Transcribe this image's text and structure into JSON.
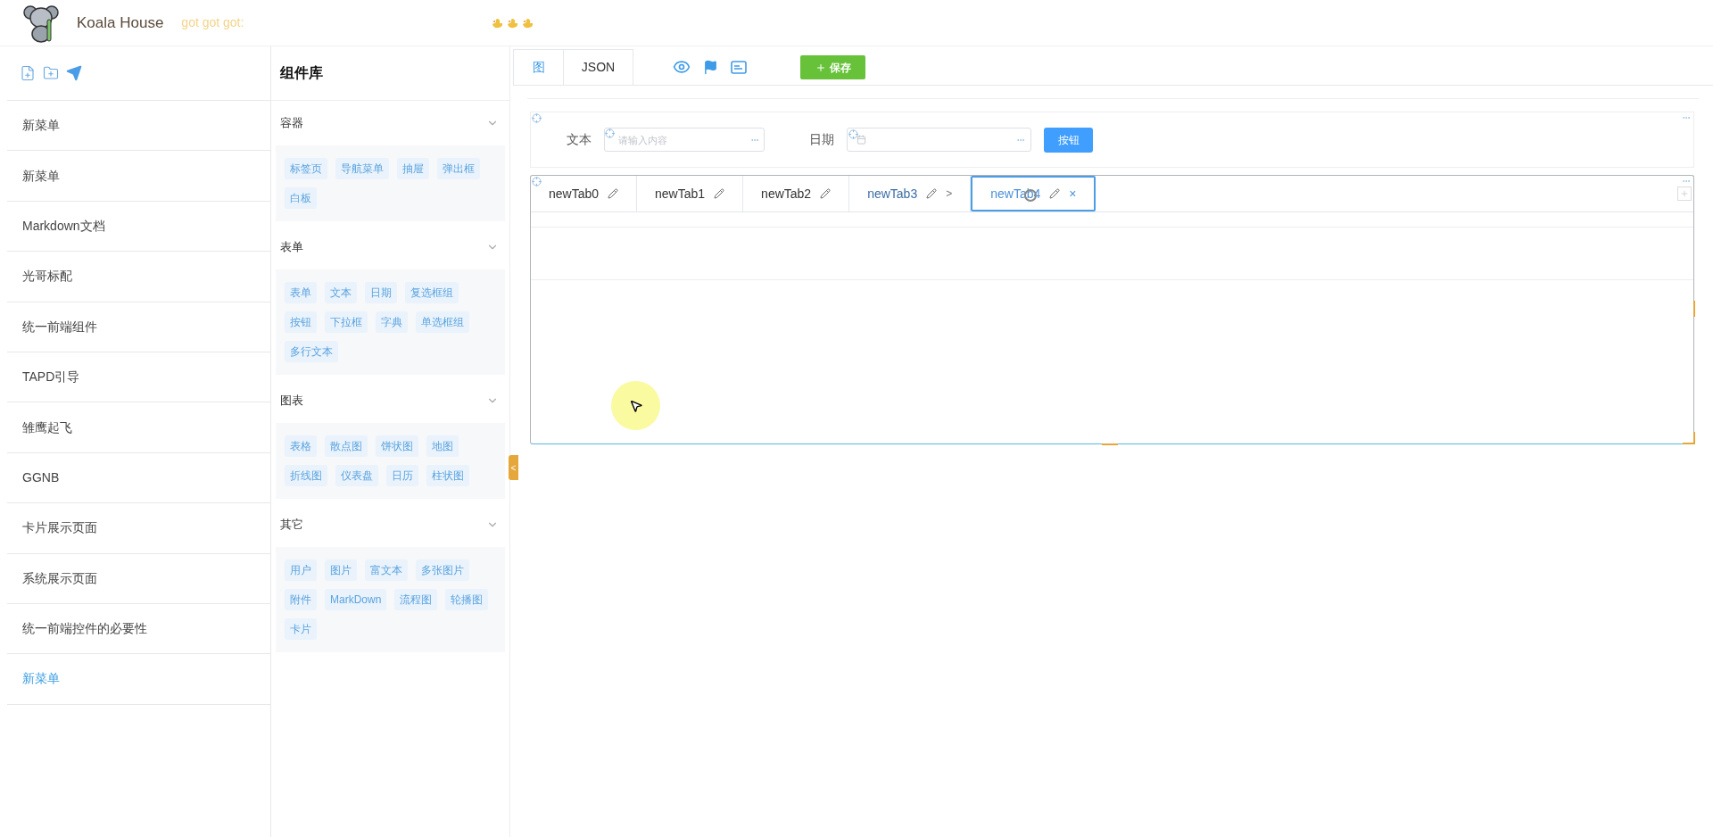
{
  "header": {
    "brand": "Koala House",
    "tagline": "got got got:"
  },
  "sidebar": {
    "items": [
      {
        "label": "新菜单",
        "selected": false
      },
      {
        "label": "新菜单",
        "selected": false
      },
      {
        "label": "Markdown文档",
        "selected": false
      },
      {
        "label": "光哥标配",
        "selected": false
      },
      {
        "label": "统一前端组件",
        "selected": false
      },
      {
        "label": "TAPD引导",
        "selected": false
      },
      {
        "label": "雏鹰起飞",
        "selected": false
      },
      {
        "label": "GGNB",
        "selected": false
      },
      {
        "label": "卡片展示页面",
        "selected": false
      },
      {
        "label": "系统展示页面",
        "selected": false
      },
      {
        "label": "统一前端控件的必要性",
        "selected": false
      },
      {
        "label": "新菜单",
        "selected": true
      }
    ]
  },
  "library": {
    "title": "组件库",
    "groups": [
      {
        "title": "容器",
        "expanded": true,
        "items": [
          "标签页",
          "导航菜单",
          "抽屉",
          "弹出框",
          "白板"
        ]
      },
      {
        "title": "表单",
        "expanded": true,
        "items": [
          "表单",
          "文本",
          "日期",
          "复选框组",
          "按钮",
          "下拉框",
          "字典",
          "单选框组",
          "多行文本"
        ]
      },
      {
        "title": "图表",
        "expanded": true,
        "items": [
          "表格",
          "散点图",
          "饼状图",
          "地图",
          "折线图",
          "仪表盘",
          "日历",
          "柱状图"
        ]
      },
      {
        "title": "其它",
        "expanded": true,
        "items": [
          "用户",
          "图片",
          "富文本",
          "多张图片",
          "附件",
          "MarkDown",
          "流程图",
          "轮播图",
          "卡片"
        ]
      }
    ],
    "collapse": "<"
  },
  "editor": {
    "tabs": [
      {
        "label": "图",
        "selected": true
      },
      {
        "label": "JSON",
        "selected": false
      }
    ],
    "save": "保存",
    "form": {
      "text_label": "文本",
      "text_placeholder": "请输入内容",
      "date_label": "日期",
      "button": "按钮"
    },
    "tabs_component": [
      {
        "label": "newTab0",
        "selected": false
      },
      {
        "label": "newTab1",
        "selected": false
      },
      {
        "label": "newTab2",
        "selected": false
      },
      {
        "label": "newTab3",
        "selected": false,
        "trailing": ">"
      },
      {
        "label": "newTab4",
        "selected": true,
        "trailing": "×",
        "loading": true
      }
    ]
  }
}
